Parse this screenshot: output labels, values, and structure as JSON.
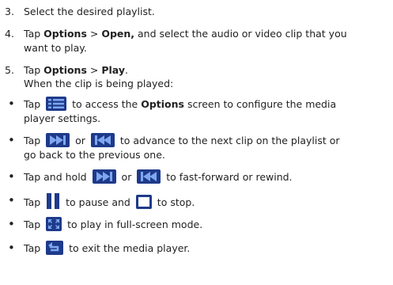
{
  "steps": [
    {
      "num": "3.",
      "text": "Select the desired playlist."
    },
    {
      "num": "4.",
      "t1": "Tap ",
      "b1": "Options",
      "t2": " > ",
      "b2": "Open,",
      "t3": " and select the audio or video clip that you",
      "line2": "want to play."
    },
    {
      "num": "5.",
      "t1": "Tap ",
      "b1": "Options",
      "t2": " > ",
      "b2": "Play",
      "t3": ".",
      "line2": "When the clip is being played:"
    }
  ],
  "bullet_char": "•",
  "bullets": [
    {
      "a": "Tap ",
      "icon": "options-list-icon",
      "b": " to access the ",
      "bold": "Options",
      "c": " screen to configure the media",
      "line2": "player settings."
    },
    {
      "a": "Tap ",
      "icon1": "next-clip-icon",
      "or": " or ",
      "icon2": "previous-clip-icon",
      "b": " to advance to the next clip on the playlist or",
      "line2": "go back to the previous one."
    },
    {
      "a": "Tap and hold ",
      "icon1": "next-clip-icon",
      "or": " or ",
      "icon2": "previous-clip-icon",
      "b": " to fast-forward or rewind."
    },
    {
      "a": "Tap ",
      "icon1": "pause-icon",
      "b": " to pause and ",
      "icon2": "stop-icon",
      "c": " to stop."
    },
    {
      "a": "Tap ",
      "icon": "fullscreen-icon",
      "b": " to play in full-screen mode."
    },
    {
      "a": "Tap ",
      "icon": "back-exit-icon",
      "b": " to exit the media player."
    }
  ],
  "colors": {
    "icon_dark": "#1e3a8a",
    "icon_light": "#4a79d8",
    "text": "#222222"
  }
}
